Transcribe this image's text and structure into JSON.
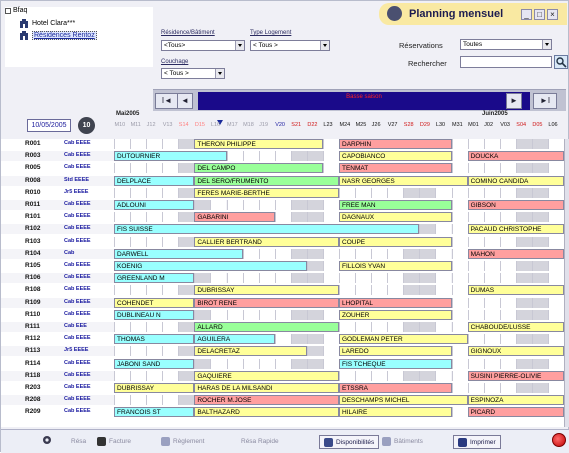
{
  "window": {
    "title": "Planning mensuel",
    "minimize": "_",
    "restore": "□",
    "close": "×"
  },
  "tree": {
    "root": "Bfaq",
    "items": [
      {
        "label": "Hotel Clara***",
        "selected": false
      },
      {
        "label": "Résidences Rentoz",
        "selected": true
      }
    ]
  },
  "filters": {
    "residence": {
      "label": "Résidence/Bâtiment",
      "value": "<Tous>"
    },
    "type_logement": {
      "label": "Type Logement",
      "value": "< Tous >"
    },
    "couchage": {
      "label": "Couchage",
      "value": "< Tous >"
    },
    "reservations": {
      "label": "Réservations",
      "value": "Toutes"
    },
    "rechercher": {
      "label": "Rechercher",
      "value": ""
    }
  },
  "nav": {
    "first": "I◄",
    "prev": "◄",
    "season": "Basse saison",
    "next": "►",
    "last": "►I"
  },
  "date_picker": {
    "value": "10/05/2005",
    "button": "10"
  },
  "timeline": {
    "months": [
      "Mai2005",
      "Juin2005"
    ],
    "days": [
      {
        "label": "M10",
        "color": "#9a9aa8"
      },
      {
        "label": "M11",
        "color": "#9a9aa8"
      },
      {
        "label": "J12",
        "color": "#9a9aa8"
      },
      {
        "label": "V13",
        "color": "#9a9aa8"
      },
      {
        "label": "S14",
        "color": "#ff8080"
      },
      {
        "label": "D15",
        "color": "#ff8080"
      },
      {
        "label": "L16",
        "color": "#9a9aa8"
      },
      {
        "label": "M17",
        "color": "#9a9aa8"
      },
      {
        "label": "M18",
        "color": "#9a9aa8"
      },
      {
        "label": "J19",
        "color": "#9a9aa8"
      },
      {
        "label": "V20",
        "color": "#1a1aa0"
      },
      {
        "label": "S21",
        "color": "#d01818"
      },
      {
        "label": "D22",
        "color": "#d01818"
      },
      {
        "label": "L23",
        "color": "#111111"
      },
      {
        "label": "M24",
        "color": "#111111"
      },
      {
        "label": "M25",
        "color": "#111111"
      },
      {
        "label": "J26",
        "color": "#111111"
      },
      {
        "label": "V27",
        "color": "#111111"
      },
      {
        "label": "S28",
        "color": "#d01818"
      },
      {
        "label": "D29",
        "color": "#d01818"
      },
      {
        "label": "L30",
        "color": "#111111"
      },
      {
        "label": "M31",
        "color": "#111111"
      },
      {
        "label": "M01",
        "color": "#111111"
      },
      {
        "label": "J02",
        "color": "#111111"
      },
      {
        "label": "V03",
        "color": "#111111"
      },
      {
        "label": "S04",
        "color": "#d01818"
      },
      {
        "label": "D05",
        "color": "#d01818"
      },
      {
        "label": "L06",
        "color": "#111111"
      }
    ]
  },
  "rows": [
    {
      "room": "R001",
      "tag": "Cab EEEE",
      "bookings": [
        {
          "name": "THERON PHILIPPE",
          "start": 5,
          "span": 8,
          "color": "#ffff99"
        },
        {
          "name": "DARPHIN",
          "start": 14,
          "span": 7,
          "color": "#ff9f9f"
        }
      ]
    },
    {
      "room": "R003",
      "tag": "Cab EEEE",
      "bookings": [
        {
          "name": "DUTOURNIER",
          "start": 0,
          "span": 7,
          "color": "#99ffff"
        },
        {
          "name": "CAPOBIANCO",
          "start": 14,
          "span": 7,
          "color": "#ffff99"
        },
        {
          "name": "DOUCKA",
          "start": 22,
          "span": 8,
          "color": "#ff9f9f"
        }
      ]
    },
    {
      "room": "R005",
      "tag": "Cab EEEE",
      "bookings": [
        {
          "name": "DEL CAMPO",
          "start": 5,
          "span": 8,
          "color": "#99ff99"
        },
        {
          "name": "TENMAT",
          "start": 14,
          "span": 7,
          "color": "#ff9f9f"
        }
      ]
    },
    {
      "room": "R008",
      "tag": "Std EEEE",
      "bookings": [
        {
          "name": "DELPLACE",
          "start": 0,
          "span": 5,
          "color": "#99ffff"
        },
        {
          "name": "DEL SERO/FRUMENTO",
          "start": 5,
          "span": 9,
          "color": "#99ff99"
        },
        {
          "name": "NASR GEORGES",
          "start": 14,
          "span": 8,
          "color": "#ffff99"
        },
        {
          "name": "COMINO CANDIDA",
          "start": 22,
          "span": 9,
          "color": "#ffff99"
        }
      ]
    },
    {
      "room": "R010",
      "tag": "Jr5 EEEE",
      "bookings": [
        {
          "name": "FERES MARIE-BERTHE",
          "start": 5,
          "span": 9,
          "color": "#ffff99"
        }
      ]
    },
    {
      "room": "R011",
      "tag": "Cab EEEE",
      "bookings": [
        {
          "name": "ADLOUNI",
          "start": 0,
          "span": 5,
          "color": "#99ffff"
        },
        {
          "name": "FREE MAN",
          "start": 14,
          "span": 7,
          "color": "#99ff99"
        },
        {
          "name": "GIBSON",
          "start": 22,
          "span": 8,
          "color": "#ff9f9f"
        }
      ]
    },
    {
      "room": "R101",
      "tag": "Cab EEEE",
      "bookings": [
        {
          "name": "GABARINI",
          "start": 5,
          "span": 5,
          "color": "#ff9f9f"
        },
        {
          "name": "DAGNAUX",
          "start": 14,
          "span": 7,
          "color": "#ffff99"
        }
      ]
    },
    {
      "room": "R102",
      "tag": "Cab EEEE",
      "bookings": [
        {
          "name": "FIS SUISSE",
          "start": 0,
          "span": 19,
          "color": "#99ffff"
        },
        {
          "name": "PACAUD CHRISTOPHE",
          "start": 22,
          "span": 9,
          "color": "#ffff99"
        }
      ]
    },
    {
      "room": "R103",
      "tag": "Cab EEEE",
      "bookings": [
        {
          "name": "CALLIER BERTRAND",
          "start": 5,
          "span": 9,
          "color": "#ffff99"
        },
        {
          "name": "COUPE",
          "start": 14,
          "span": 7,
          "color": "#ffff99"
        }
      ]
    },
    {
      "room": "R104",
      "tag": "Cab",
      "bookings": [
        {
          "name": "DARWELL",
          "start": 0,
          "span": 8,
          "color": "#99ffff"
        },
        {
          "name": "MAHON",
          "start": 22,
          "span": 11,
          "color": "#ff9f9f"
        }
      ]
    },
    {
      "room": "R105",
      "tag": "Cab EEEE",
      "bookings": [
        {
          "name": "KOENIG",
          "start": 0,
          "span": 12,
          "color": "#99ffff"
        },
        {
          "name": "FILLOIS YVAN",
          "start": 14,
          "span": 7,
          "color": "#ffff99"
        }
      ]
    },
    {
      "room": "R106",
      "tag": "Cab EEEE",
      "bookings": [
        {
          "name": "GREENLAND M",
          "start": 0,
          "span": 5,
          "color": "#99ffff"
        }
      ]
    },
    {
      "room": "R108",
      "tag": "Cab EEEE",
      "bookings": [
        {
          "name": "DUBRISSAY",
          "start": 5,
          "span": 9,
          "color": "#ffff99"
        },
        {
          "name": "DUMAS",
          "start": 22,
          "span": 8,
          "color": "#ffff99"
        }
      ]
    },
    {
      "room": "R109",
      "tag": "Cab EEEE",
      "bookings": [
        {
          "name": "COHENDET",
          "start": 0,
          "span": 5,
          "color": "#ffff99"
        },
        {
          "name": "BIROT RENE",
          "start": 5,
          "span": 9,
          "color": "#ff9f9f"
        },
        {
          "name": "LHOPITAL",
          "start": 14,
          "span": 7,
          "color": "#ff9f9f"
        }
      ]
    },
    {
      "room": "R110",
      "tag": "Cab EEEE",
      "bookings": [
        {
          "name": "DUBLINEAU N",
          "start": 0,
          "span": 5,
          "color": "#99ffff"
        },
        {
          "name": "ZOUHER",
          "start": 14,
          "span": 7,
          "color": "#ffff99"
        }
      ]
    },
    {
      "room": "R111",
      "tag": "Cab EEE",
      "bookings": [
        {
          "name": "ALLARD",
          "start": 5,
          "span": 9,
          "color": "#99ff99"
        },
        {
          "name": "CHABOUDE/LUSSE",
          "start": 22,
          "span": 8,
          "color": "#ffff99"
        }
      ]
    },
    {
      "room": "R112",
      "tag": "Cab EEEE",
      "bookings": [
        {
          "name": "THOMAS",
          "start": 0,
          "span": 5,
          "color": "#99ffff"
        },
        {
          "name": "AGUILERA",
          "start": 5,
          "span": 5,
          "color": "#99ffff"
        },
        {
          "name": "GODLEMAN PETER",
          "start": 14,
          "span": 8,
          "color": "#ffff99"
        }
      ]
    },
    {
      "room": "R113",
      "tag": "Jr5 EEEE",
      "bookings": [
        {
          "name": "DELACRETAZ",
          "start": 5,
          "span": 7,
          "color": "#ffff99"
        },
        {
          "name": "LAREDO",
          "start": 14,
          "span": 7,
          "color": "#ffff99"
        },
        {
          "name": "GIGNOUX",
          "start": 22,
          "span": 8,
          "color": "#ffff99"
        }
      ]
    },
    {
      "room": "R114",
      "tag": "Cab EEEE",
      "bookings": [
        {
          "name": "JABONI SAND",
          "start": 0,
          "span": 5,
          "color": "#99ffff"
        },
        {
          "name": "FIS TCHEQUE",
          "start": 14,
          "span": 7,
          "color": "#99ffff"
        }
      ]
    },
    {
      "room": "R118",
      "tag": "Cab EEEE",
      "bookings": [
        {
          "name": "GAQUIERE",
          "start": 5,
          "span": 9,
          "color": "#ffff99"
        },
        {
          "name": "SUSINI PIERRE-OLIVIE",
          "start": 22,
          "span": 8,
          "color": "#ff9f9f"
        }
      ]
    },
    {
      "room": "R203",
      "tag": "Cab EEEE",
      "bookings": [
        {
          "name": "DUBRISSAY",
          "start": 0,
          "span": 5,
          "color": "#ffff99"
        },
        {
          "name": "HARAS DE LA MILSANDI",
          "start": 5,
          "span": 9,
          "color": "#ffff99"
        },
        {
          "name": "ETSSRA",
          "start": 14,
          "span": 7,
          "color": "#ff9f9f"
        }
      ]
    },
    {
      "room": "R208",
      "tag": "Cab EEEE",
      "bookings": [
        {
          "name": "ROCHER M.JOSE",
          "start": 5,
          "span": 9,
          "color": "#ff9f9f"
        },
        {
          "name": "DESCHAMPS MICHEL",
          "start": 14,
          "span": 8,
          "color": "#ffff99"
        },
        {
          "name": "ESPINOZA",
          "start": 22,
          "span": 6,
          "color": "#ffff99"
        }
      ]
    },
    {
      "room": "R209",
      "tag": "Cab EEEE",
      "bookings": [
        {
          "name": "FRANCOIS ST",
          "start": 0,
          "span": 5,
          "color": "#99ffff"
        },
        {
          "name": "BALTHAZARD",
          "start": 5,
          "span": 9,
          "color": "#ffff99"
        },
        {
          "name": "HILAIRE",
          "start": 14,
          "span": 7,
          "color": "#ffff99"
        },
        {
          "name": "PICARD",
          "start": 22,
          "span": 8,
          "color": "#ff9f9f"
        }
      ]
    }
  ],
  "toolbar": {
    "resa": "Résa",
    "facture": "Facture",
    "reglement": "Règlement",
    "resa_rapide": "Résa Rapide",
    "disponibilites": "Disponibilités",
    "batiments": "Bâtiments",
    "imprimer": "Imprimer"
  },
  "colors": {
    "title_bar": "#f9e9a2",
    "season_bar": "#1a0a8a",
    "season_text": "#ff2020",
    "client_cyan": "#99ffff",
    "client_yellow": "#ffff99",
    "client_pink": "#ff9f9f",
    "client_green": "#99ff99"
  }
}
